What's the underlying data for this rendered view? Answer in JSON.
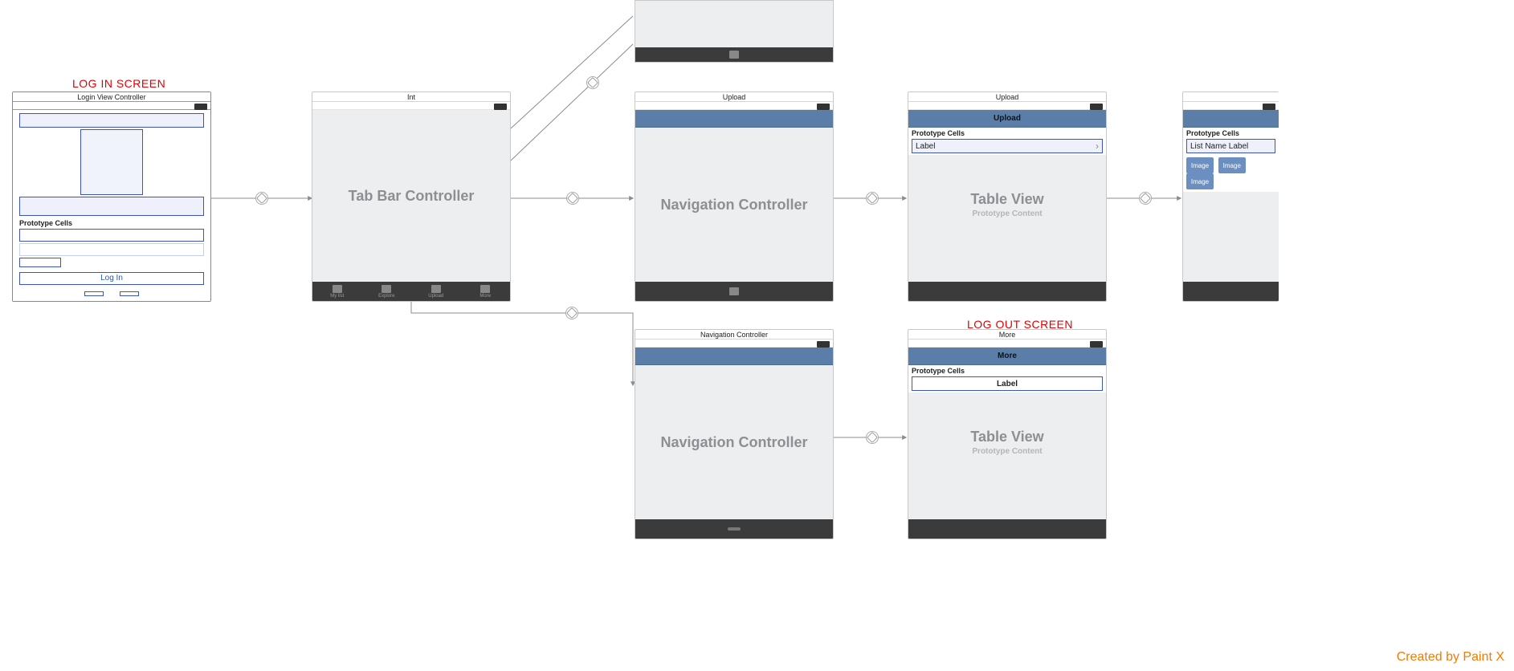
{
  "annotations": {
    "log_in": "LOG IN SCREEN",
    "log_out": "LOG OUT SCREEN"
  },
  "scenes": {
    "login": {
      "title": "Login View Controller",
      "prototype_cells": "Prototype Cells",
      "button": "Log In"
    },
    "tabbar": {
      "title": "Int",
      "label": "Tab Bar Controller",
      "tabs": [
        "My list",
        "Explore",
        "Upload",
        "More"
      ]
    },
    "nav_upload": {
      "title": "Upload",
      "label": "Navigation Controller"
    },
    "table_upload": {
      "title": "Upload",
      "nav_title": "Upload",
      "big": "Table View",
      "sub": "Prototype Content",
      "prototype_cells": "Prototype Cells",
      "cell_label": "Label"
    },
    "listname": {
      "prototype_cells": "Prototype Cells",
      "cell_label": "List Name Label",
      "chip": "Image"
    },
    "nav_more": {
      "title": "Navigation Controller",
      "label": "Navigation Controller"
    },
    "table_more": {
      "title": "More",
      "nav_title": "More",
      "big": "Table View",
      "sub": "Prototype Content",
      "prototype_cells": "Prototype Cells",
      "cell_label": "Label"
    }
  },
  "watermark": "Created by Paint X"
}
